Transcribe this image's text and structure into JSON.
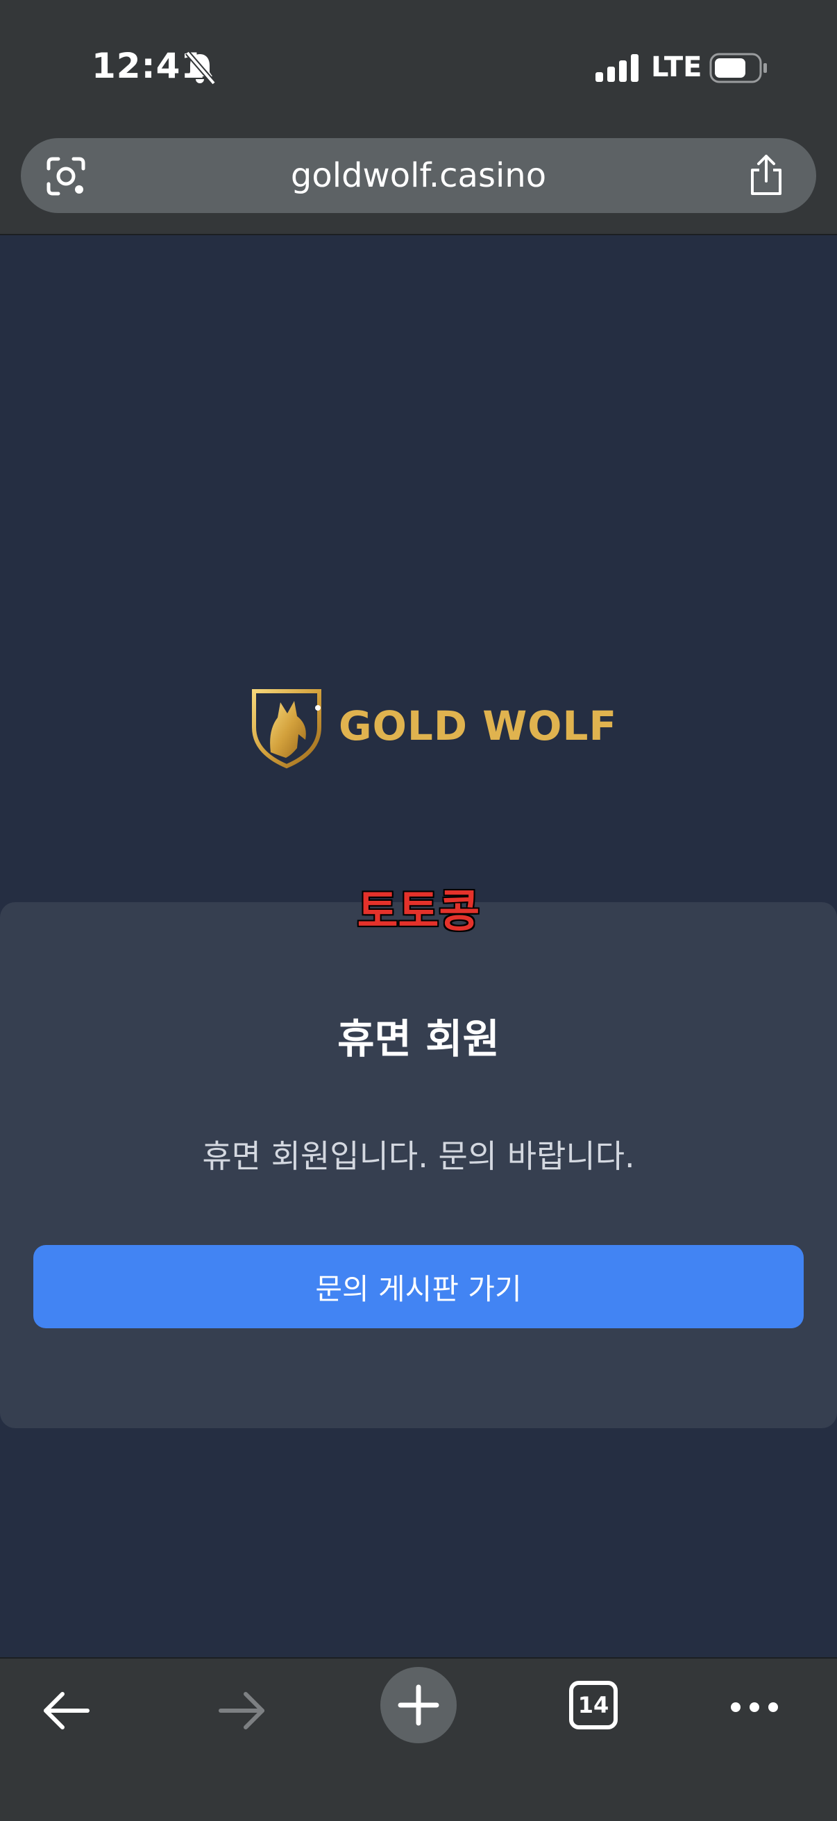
{
  "status_bar": {
    "time": "12:41",
    "network": "LTE"
  },
  "browser": {
    "url": "goldwolf.casino",
    "tab_count": "14"
  },
  "brand": {
    "name": "GOLD WOLF",
    "color": "#e0b34f"
  },
  "watermark": "토토콩",
  "modal": {
    "title": "휴면 회원",
    "message": "휴면 회원입니다. 문의 바랍니다.",
    "button_label": "문의 게시판 가기",
    "button_color": "#4284f3"
  },
  "icons": {
    "status": [
      "bell-slash-icon",
      "signal-icon",
      "battery-icon"
    ],
    "urlbar": [
      "lens-icon",
      "share-icon"
    ],
    "toolbar": [
      "back-arrow-icon",
      "forward-arrow-icon",
      "plus-icon",
      "tabs-icon",
      "more-icon"
    ]
  }
}
